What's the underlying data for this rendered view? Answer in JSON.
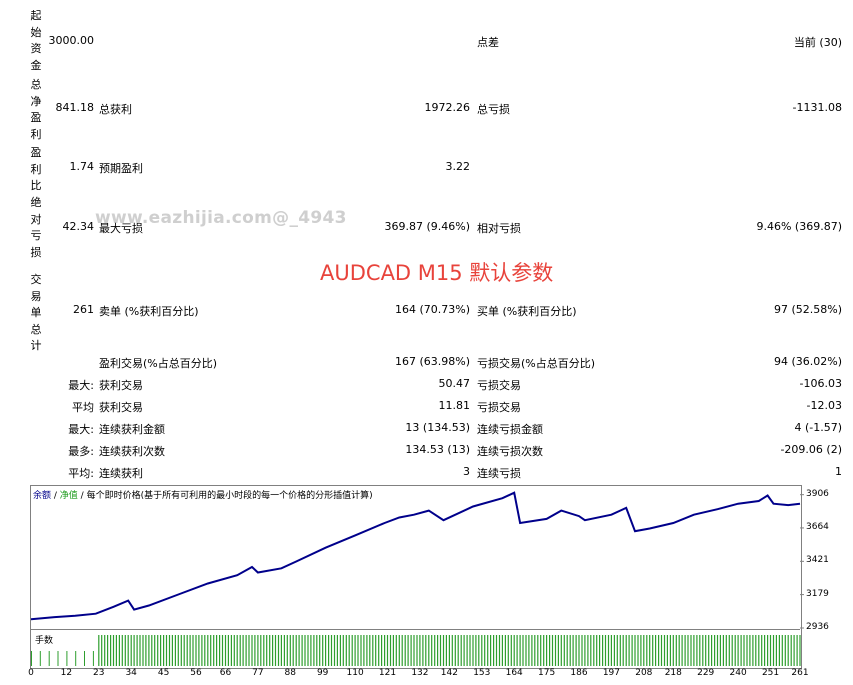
{
  "side_labels": [
    "起始资金",
    "总净盈利",
    "盈利比",
    "绝对亏损",
    "交易单总计"
  ],
  "stats": {
    "initial_deposit": "3000.00",
    "spread_label": "点差",
    "spread_value": "当前 (30)",
    "net_profit": "841.18",
    "gross_profit_label": "总获利",
    "gross_profit": "1972.26",
    "gross_loss_label": "总亏损",
    "gross_loss": "-1131.08",
    "profit_factor": "1.74",
    "expected_payoff_label": "预期盈利",
    "expected_payoff": "3.22",
    "abs_drawdown": "42.34",
    "max_drawdown_label": "最大亏损",
    "max_drawdown": "369.87 (9.46%)",
    "rel_drawdown_label": "相对亏损",
    "rel_drawdown": "9.46% (369.87)",
    "total_trades": "261",
    "short_label": "卖单 (%获利百分比)",
    "short_value": "164 (70.73%)",
    "long_label": "买单 (%获利百分比)",
    "long_value": "97 (52.58%)",
    "win_label": "盈利交易(%占总百分比)",
    "win_value": "167 (63.98%)",
    "loss_label": "亏损交易(%占总百分比)",
    "loss_value": "94 (36.02%)"
  },
  "rows": [
    {
      "prefix": "最大:",
      "l_label": "获利交易",
      "l_value": "50.47",
      "r_label": "亏损交易",
      "r_value": "-106.03"
    },
    {
      "prefix": "平均",
      "l_label": "获利交易",
      "l_value": "11.81",
      "r_label": "亏损交易",
      "r_value": "-12.03"
    },
    {
      "prefix": "最大:",
      "l_label": "连续获利金额",
      "l_value": "13 (134.53)",
      "r_label": "连续亏损金额",
      "r_value": "4 (-1.57)"
    },
    {
      "prefix": "最多:",
      "l_label": "连续获利次数",
      "l_value": "134.53 (13)",
      "r_label": "连续亏损次数",
      "r_value": "-209.06 (2)"
    },
    {
      "prefix": "平均:",
      "l_label": "连续获利",
      "l_value": "3",
      "r_label": "连续亏损",
      "r_value": "1"
    }
  ],
  "watermark": "www.eazhijia.com@_4943",
  "banner": "AUDCAD M15 默认参数",
  "chart_legend": {
    "balance": "余额",
    "sep1": " / ",
    "equity": "净值",
    "sep2": " / ",
    "mode": "每个即时价格(基于所有可利用的最小时段的每一个价格的分形插值计算)"
  },
  "volume_label": "手数",
  "colors": {
    "balance_line": "#00008b",
    "volume_bar": "#2e9e2e",
    "banner": "#e8433b"
  },
  "chart_data": {
    "type": "line",
    "title": "",
    "xlabel": "",
    "ylabel": "",
    "x_ticks": [
      0,
      12,
      23,
      34,
      45,
      56,
      66,
      77,
      88,
      99,
      110,
      121,
      132,
      142,
      153,
      164,
      175,
      186,
      197,
      208,
      218,
      229,
      240,
      251,
      261
    ],
    "y_ticks": [
      2936,
      3179,
      3421,
      3664,
      3906
    ],
    "xlim": [
      0,
      261
    ],
    "ylim": [
      2936,
      3940
    ],
    "series": [
      {
        "values": [
          [
            0,
            3000
          ],
          [
            8,
            3015
          ],
          [
            15,
            3025
          ],
          [
            22,
            3040
          ],
          [
            28,
            3090
          ],
          [
            33,
            3135
          ],
          [
            35,
            3070
          ],
          [
            40,
            3100
          ],
          [
            50,
            3180
          ],
          [
            60,
            3260
          ],
          [
            70,
            3320
          ],
          [
            75,
            3380
          ],
          [
            77,
            3340
          ],
          [
            85,
            3370
          ],
          [
            90,
            3420
          ],
          [
            100,
            3520
          ],
          [
            110,
            3610
          ],
          [
            120,
            3700
          ],
          [
            125,
            3740
          ],
          [
            130,
            3760
          ],
          [
            135,
            3790
          ],
          [
            140,
            3720
          ],
          [
            150,
            3820
          ],
          [
            160,
            3880
          ],
          [
            164,
            3920
          ],
          [
            166,
            3700
          ],
          [
            175,
            3730
          ],
          [
            180,
            3790
          ],
          [
            186,
            3750
          ],
          [
            188,
            3720
          ],
          [
            197,
            3760
          ],
          [
            202,
            3810
          ],
          [
            205,
            3640
          ],
          [
            210,
            3660
          ],
          [
            218,
            3700
          ],
          [
            225,
            3760
          ],
          [
            233,
            3800
          ],
          [
            240,
            3840
          ],
          [
            247,
            3860
          ],
          [
            250,
            3900
          ],
          [
            252,
            3840
          ],
          [
            257,
            3830
          ],
          [
            261,
            3840
          ]
        ]
      }
    ]
  }
}
